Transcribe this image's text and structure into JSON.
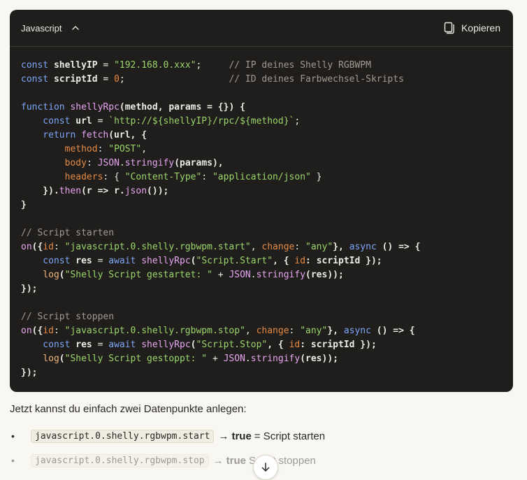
{
  "code_block": {
    "language": "Javascript",
    "copy_label": "Kopieren",
    "lines": [
      [
        {
          "t": "const ",
          "c": "kw"
        },
        {
          "t": "shellyIP",
          "c": "tx"
        },
        {
          "t": " = ",
          "c": "pl"
        },
        {
          "t": "\"192.168.0.xxx\"",
          "c": "st"
        },
        {
          "t": ";     ",
          "c": "pl"
        },
        {
          "t": "// IP deines Shelly RGBWPM",
          "c": "cm"
        }
      ],
      [
        {
          "t": "const ",
          "c": "kw"
        },
        {
          "t": "scriptId",
          "c": "tx"
        },
        {
          "t": " = ",
          "c": "pl"
        },
        {
          "t": "0",
          "c": "nm"
        },
        {
          "t": ";                   ",
          "c": "pl"
        },
        {
          "t": "// ID deines Farbwechsel-Skripts",
          "c": "cm"
        }
      ],
      [],
      [
        {
          "t": "function ",
          "c": "kw"
        },
        {
          "t": "shellyRpc",
          "c": "fc"
        },
        {
          "t": "(method, params = {}) {",
          "c": "tx"
        }
      ],
      [
        {
          "t": "    const ",
          "c": "kw"
        },
        {
          "t": "url",
          "c": "tx"
        },
        {
          "t": " = ",
          "c": "pl"
        },
        {
          "t": "`http://${shellyIP}/rpc/${method}`",
          "c": "st"
        },
        {
          "t": ";",
          "c": "pl"
        }
      ],
      [
        {
          "t": "    return ",
          "c": "kw"
        },
        {
          "t": "fetch",
          "c": "fc"
        },
        {
          "t": "(url, {",
          "c": "tx"
        }
      ],
      [
        {
          "t": "        ",
          "c": "pl"
        },
        {
          "t": "method",
          "c": "pr"
        },
        {
          "t": ": ",
          "c": "pl"
        },
        {
          "t": "\"POST\"",
          "c": "st"
        },
        {
          "t": ",",
          "c": "pl"
        }
      ],
      [
        {
          "t": "        ",
          "c": "pl"
        },
        {
          "t": "body",
          "c": "pr"
        },
        {
          "t": ": ",
          "c": "pl"
        },
        {
          "t": "JSON",
          "c": "fc"
        },
        {
          "t": ".",
          "c": "pl"
        },
        {
          "t": "stringify",
          "c": "fc"
        },
        {
          "t": "(params),",
          "c": "tx"
        }
      ],
      [
        {
          "t": "        ",
          "c": "pl"
        },
        {
          "t": "headers",
          "c": "pr"
        },
        {
          "t": ": { ",
          "c": "pl"
        },
        {
          "t": "\"Content-Type\"",
          "c": "st"
        },
        {
          "t": ": ",
          "c": "pl"
        },
        {
          "t": "\"application/json\"",
          "c": "st"
        },
        {
          "t": " }",
          "c": "pl"
        }
      ],
      [
        {
          "t": "    }).",
          "c": "tx"
        },
        {
          "t": "then",
          "c": "fc"
        },
        {
          "t": "(r => r.",
          "c": "tx"
        },
        {
          "t": "json",
          "c": "fc"
        },
        {
          "t": "());",
          "c": "tx"
        }
      ],
      [
        {
          "t": "}",
          "c": "tx"
        }
      ],
      [],
      [
        {
          "t": "// Script starten",
          "c": "cm"
        }
      ],
      [
        {
          "t": "on",
          "c": "fc"
        },
        {
          "t": "({",
          "c": "tx"
        },
        {
          "t": "id",
          "c": "pr"
        },
        {
          "t": ": ",
          "c": "pl"
        },
        {
          "t": "\"javascript.0.shelly.rgbwpm.start\"",
          "c": "st"
        },
        {
          "t": ", ",
          "c": "pl"
        },
        {
          "t": "change",
          "c": "pr"
        },
        {
          "t": ": ",
          "c": "pl"
        },
        {
          "t": "\"any\"",
          "c": "st"
        },
        {
          "t": "}, ",
          "c": "tx"
        },
        {
          "t": "async",
          "c": "kw"
        },
        {
          "t": " () => {",
          "c": "tx"
        }
      ],
      [
        {
          "t": "    const ",
          "c": "kw"
        },
        {
          "t": "res",
          "c": "tx"
        },
        {
          "t": " = ",
          "c": "pl"
        },
        {
          "t": "await ",
          "c": "kw"
        },
        {
          "t": "shellyRpc",
          "c": "fc"
        },
        {
          "t": "(",
          "c": "tx"
        },
        {
          "t": "\"Script.Start\"",
          "c": "st"
        },
        {
          "t": ", { ",
          "c": "tx"
        },
        {
          "t": "id",
          "c": "pr"
        },
        {
          "t": ": scriptId });",
          "c": "tx"
        }
      ],
      [
        {
          "t": "    ",
          "c": "pl"
        },
        {
          "t": "log",
          "c": "fn"
        },
        {
          "t": "(",
          "c": "tx"
        },
        {
          "t": "\"Shelly Script gestartet: \"",
          "c": "st"
        },
        {
          "t": " + ",
          "c": "pl"
        },
        {
          "t": "JSON",
          "c": "fc"
        },
        {
          "t": ".",
          "c": "pl"
        },
        {
          "t": "stringify",
          "c": "fc"
        },
        {
          "t": "(res));",
          "c": "tx"
        }
      ],
      [
        {
          "t": "});",
          "c": "tx"
        }
      ],
      [],
      [
        {
          "t": "// Script stoppen",
          "c": "cm"
        }
      ],
      [
        {
          "t": "on",
          "c": "fc"
        },
        {
          "t": "({",
          "c": "tx"
        },
        {
          "t": "id",
          "c": "pr"
        },
        {
          "t": ": ",
          "c": "pl"
        },
        {
          "t": "\"javascript.0.shelly.rgbwpm.stop\"",
          "c": "st"
        },
        {
          "t": ", ",
          "c": "pl"
        },
        {
          "t": "change",
          "c": "pr"
        },
        {
          "t": ": ",
          "c": "pl"
        },
        {
          "t": "\"any\"",
          "c": "st"
        },
        {
          "t": "}, ",
          "c": "tx"
        },
        {
          "t": "async",
          "c": "kw"
        },
        {
          "t": " () => {",
          "c": "tx"
        }
      ],
      [
        {
          "t": "    const ",
          "c": "kw"
        },
        {
          "t": "res",
          "c": "tx"
        },
        {
          "t": " = ",
          "c": "pl"
        },
        {
          "t": "await ",
          "c": "kw"
        },
        {
          "t": "shellyRpc",
          "c": "fc"
        },
        {
          "t": "(",
          "c": "tx"
        },
        {
          "t": "\"Script.Stop\"",
          "c": "st"
        },
        {
          "t": ", { ",
          "c": "tx"
        },
        {
          "t": "id",
          "c": "pr"
        },
        {
          "t": ": scriptId });",
          "c": "tx"
        }
      ],
      [
        {
          "t": "    ",
          "c": "pl"
        },
        {
          "t": "log",
          "c": "fn"
        },
        {
          "t": "(",
          "c": "tx"
        },
        {
          "t": "\"Shelly Script gestoppt: \"",
          "c": "st"
        },
        {
          "t": " + ",
          "c": "pl"
        },
        {
          "t": "JSON",
          "c": "fc"
        },
        {
          "t": ".",
          "c": "pl"
        },
        {
          "t": "stringify",
          "c": "fc"
        },
        {
          "t": "(res));",
          "c": "tx"
        }
      ],
      [
        {
          "t": "});",
          "c": "tx"
        }
      ]
    ]
  },
  "paragraph": "Jetzt kannst du einfach zwei Datenpunkte anlegen:",
  "bullets": [
    {
      "bullet": "•",
      "code": "javascript.0.shelly.rgbwpm.start",
      "arrow": "→",
      "bold": "true",
      "rest": "= Script starten"
    },
    {
      "bullet": "•",
      "code": "javascript.0.shelly.rgbwpm.stop",
      "arrow": "→",
      "bold": "true",
      "rest": "Script stoppen"
    }
  ],
  "icons": {
    "collapse": "chevron-up-icon",
    "copy": "copy-icon",
    "scroll": "arrow-down-icon"
  },
  "colors": {
    "code_bg": "#1f1e1c",
    "page_bg": "#f9f7f2",
    "keyword": "#7ea6f7",
    "string": "#9bd56a",
    "comment": "#a09a90",
    "property": "#e58a44"
  }
}
